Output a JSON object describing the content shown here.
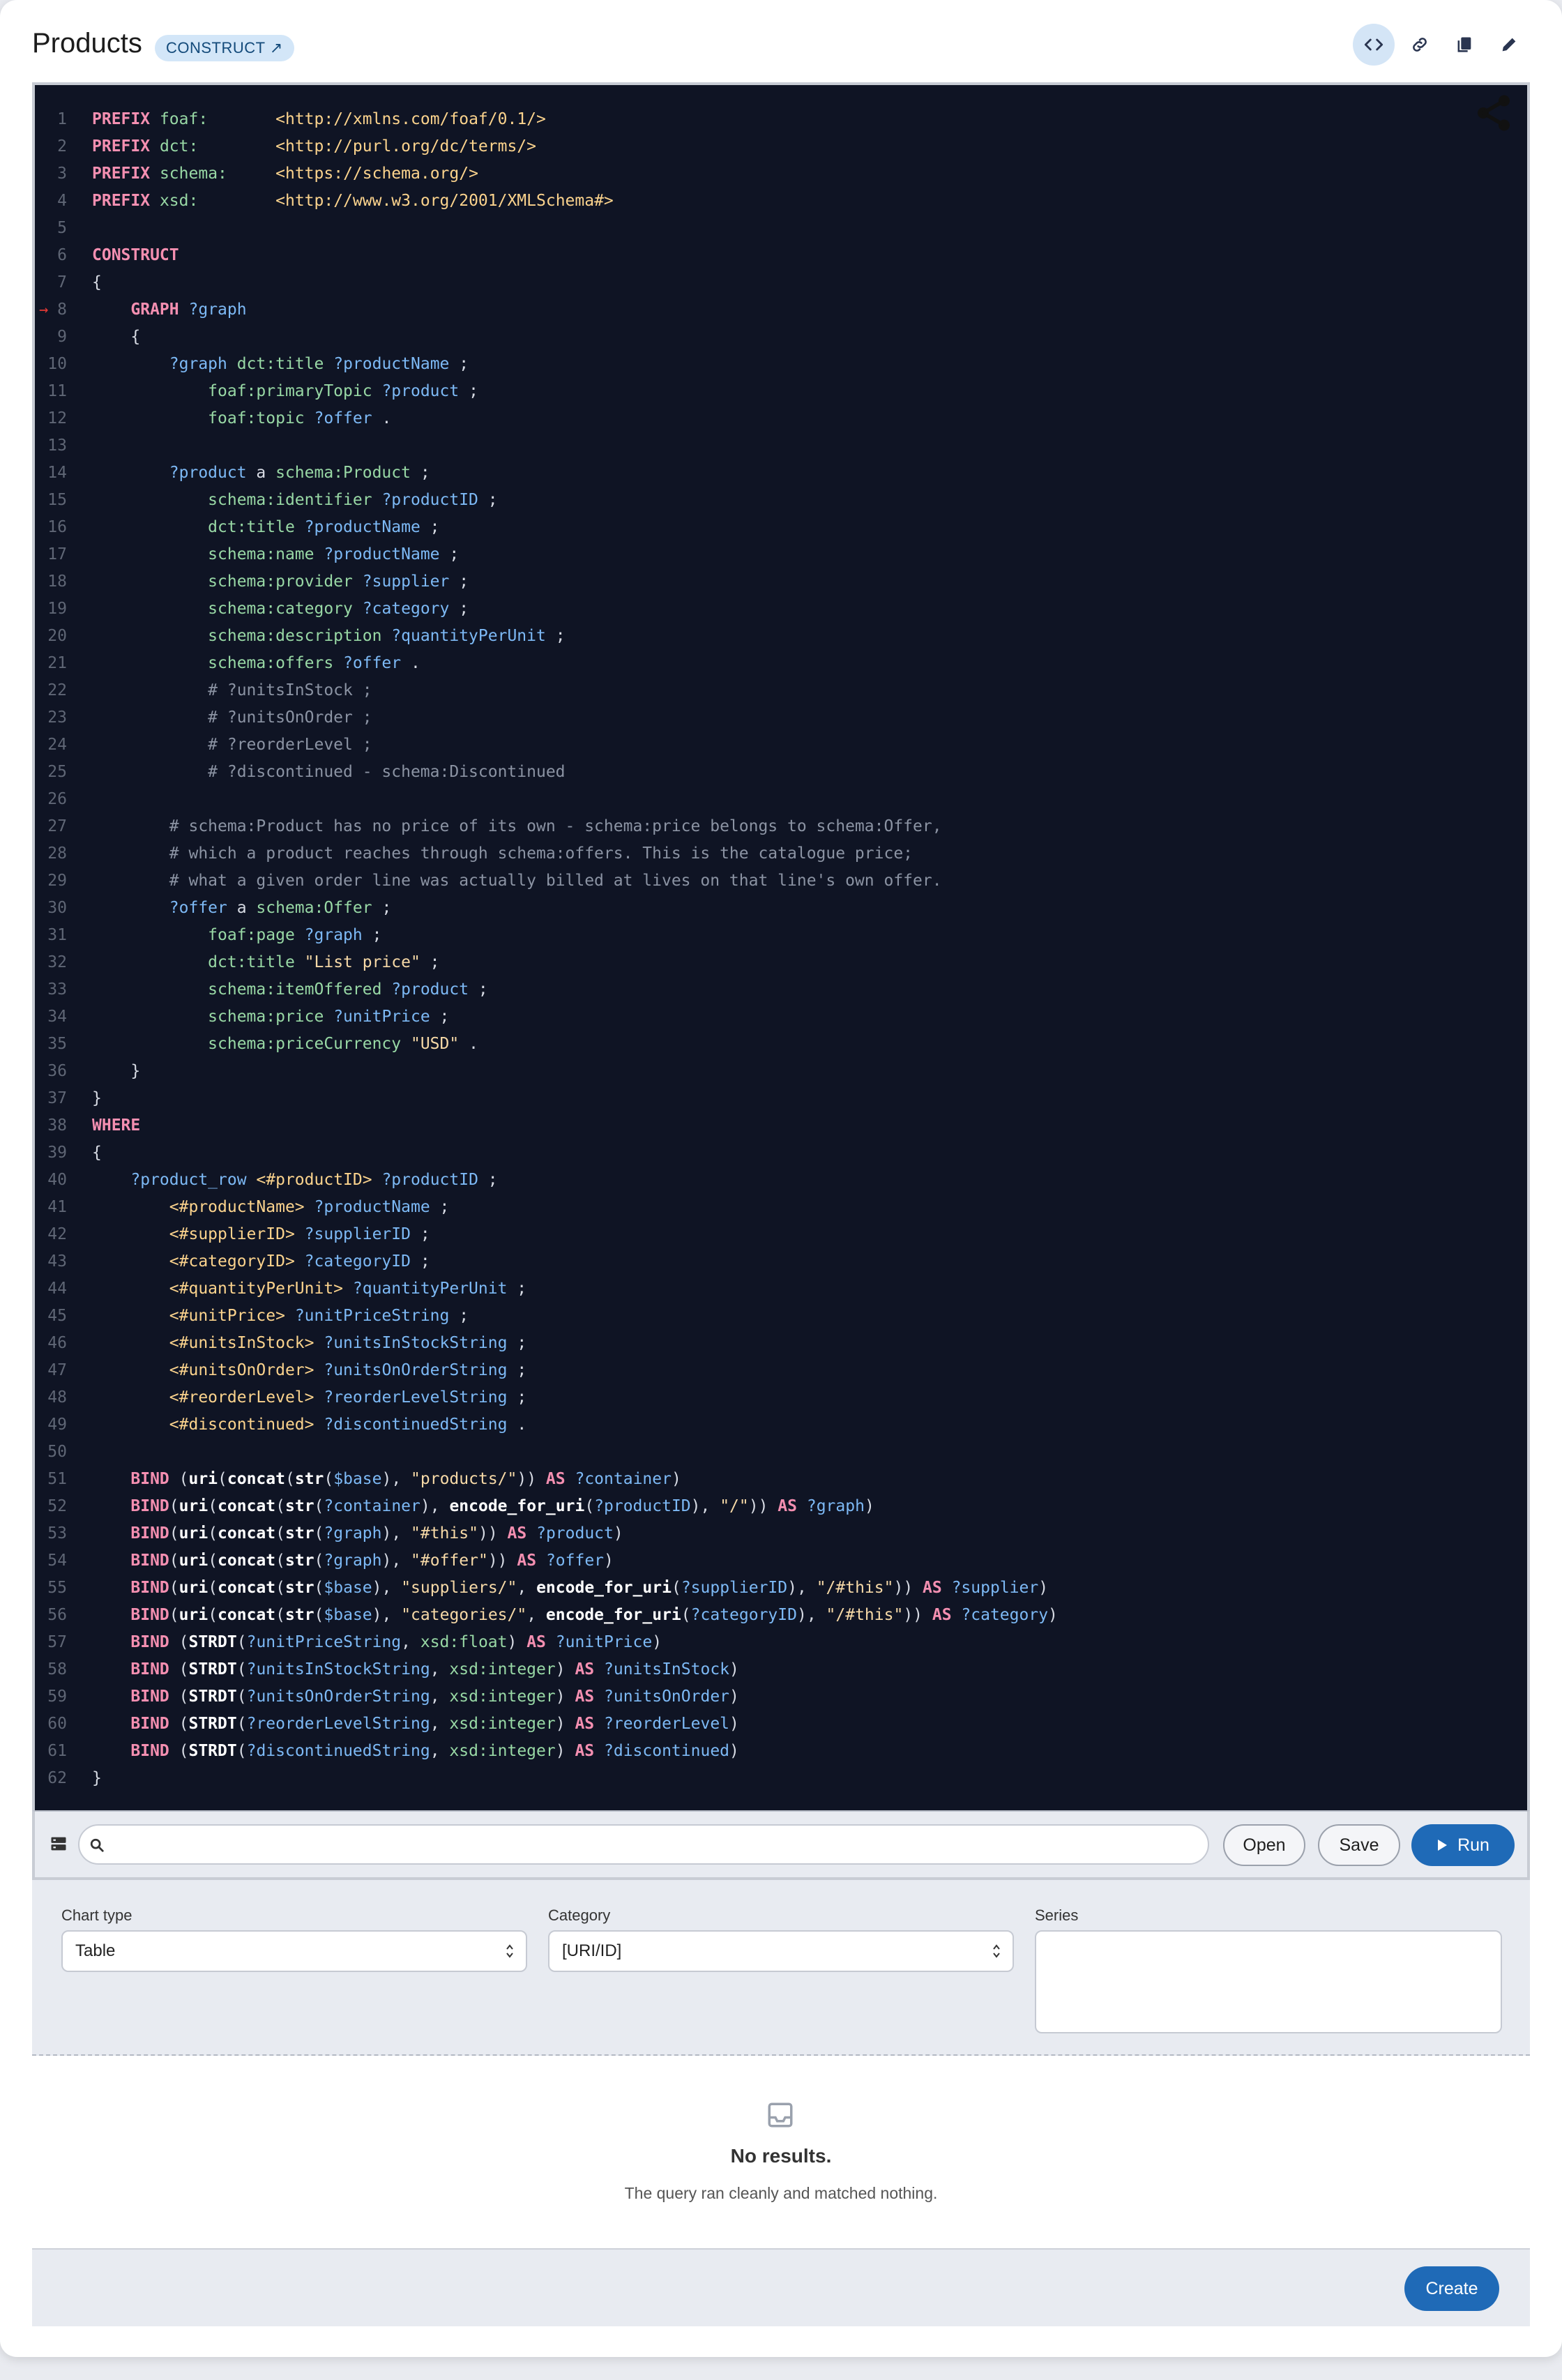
{
  "header": {
    "title": "Products",
    "badge": "CONSTRUCT ↗",
    "buttons": [
      "code-view",
      "link",
      "copy",
      "edit"
    ]
  },
  "colors": {
    "accent": "#1f6ab7",
    "editor_bg": "#0f1424",
    "badge_bg": "#d3e6f8"
  },
  "editor": {
    "lines": [
      "<span class=\"k\">PREFIX</span> <span class=\"p\">foaf:</span>       <span class=\"i\">&lt;http://xmlns.com/foaf/0.1/&gt;</span>",
      "<span class=\"k\">PREFIX</span> <span class=\"p\">dct:</span>        <span class=\"i\">&lt;http://purl.org/dc/terms/&gt;</span>",
      "<span class=\"k\">PREFIX</span> <span class=\"p\">schema:</span>     <span class=\"i\">&lt;https://schema.org/&gt;</span>",
      "<span class=\"k\">PREFIX</span> <span class=\"p\">xsd:</span>        <span class=\"i\">&lt;http://www.w3.org/2001/XMLSchema#&gt;</span>",
      "",
      "<span class=\"k\">CONSTRUCT</span>",
      "{",
      "    <span class=\"k\">GRAPH</span> <span class=\"v\">?graph</span>",
      "    {",
      "        <span class=\"v\">?graph</span> <span class=\"p\">dct:title</span> <span class=\"v\">?productName</span> ;",
      "            <span class=\"p\">foaf:primaryTopic</span> <span class=\"v\">?product</span> ;",
      "            <span class=\"p\">foaf:topic</span> <span class=\"v\">?offer</span> .",
      "",
      "        <span class=\"v\">?product</span> a <span class=\"p\">schema:Product</span> ;",
      "            <span class=\"p\">schema:identifier</span> <span class=\"v\">?productID</span> ;",
      "            <span class=\"p\">dct:title</span> <span class=\"v\">?productName</span> ;",
      "            <span class=\"p\">schema:name</span> <span class=\"v\">?productName</span> ;",
      "            <span class=\"p\">schema:provider</span> <span class=\"v\">?supplier</span> ;",
      "            <span class=\"p\">schema:category</span> <span class=\"v\">?category</span> ;",
      "            <span class=\"p\">schema:description</span> <span class=\"v\">?quantityPerUnit</span> ;",
      "            <span class=\"p\">schema:offers</span> <span class=\"v\">?offer</span> .",
      "            <span class=\"c\"># ?unitsInStock ;</span>",
      "            <span class=\"c\"># ?unitsOnOrder ;</span>",
      "            <span class=\"c\"># ?reorderLevel ;</span>",
      "            <span class=\"c\"># ?discontinued - schema:Discontinued</span>",
      "",
      "        <span class=\"c\"># schema:Product has no price of its own - schema:price belongs to schema:Offer,</span>",
      "        <span class=\"c\"># which a product reaches through schema:offers. This is the catalogue price;</span>",
      "        <span class=\"c\"># what a given order line was actually billed at lives on that line's own offer.</span>",
      "        <span class=\"v\">?offer</span> a <span class=\"p\">schema:Offer</span> ;",
      "            <span class=\"p\">foaf:page</span> <span class=\"v\">?graph</span> ;",
      "            <span class=\"p\">dct:title</span> <span class=\"s\">\"List price\"</span> ;",
      "            <span class=\"p\">schema:itemOffered</span> <span class=\"v\">?product</span> ;",
      "            <span class=\"p\">schema:price</span> <span class=\"v\">?unitPrice</span> ;",
      "            <span class=\"p\">schema:priceCurrency</span> <span class=\"s\">\"USD\"</span> .",
      "    }",
      "}",
      "<span class=\"k\">WHERE</span>",
      "{",
      "    <span class=\"v\">?product_row</span> <span class=\"i\">&lt;#productID&gt;</span> <span class=\"v\">?productID</span> ;",
      "        <span class=\"i\">&lt;#productName&gt;</span> <span class=\"v\">?productName</span> ;",
      "        <span class=\"i\">&lt;#supplierID&gt;</span> <span class=\"v\">?supplierID</span> ;",
      "        <span class=\"i\">&lt;#categoryID&gt;</span> <span class=\"v\">?categoryID</span> ;",
      "        <span class=\"i\">&lt;#quantityPerUnit&gt;</span> <span class=\"v\">?quantityPerUnit</span> ;",
      "        <span class=\"i\">&lt;#unitPrice&gt;</span> <span class=\"v\">?unitPriceString</span> ;",
      "        <span class=\"i\">&lt;#unitsInStock&gt;</span> <span class=\"v\">?unitsInStockString</span> ;",
      "        <span class=\"i\">&lt;#unitsOnOrder&gt;</span> <span class=\"v\">?unitsOnOrderString</span> ;",
      "        <span class=\"i\">&lt;#reorderLevel&gt;</span> <span class=\"v\">?reorderLevelString</span> ;",
      "        <span class=\"i\">&lt;#discontinued&gt;</span> <span class=\"v\">?discontinuedString</span> .",
      "",
      "    <span class=\"k\">BIND</span> (<span class=\"f\">uri</span>(<span class=\"f\">concat</span>(<span class=\"f\">str</span>(<span class=\"v\">$base</span>), <span class=\"s\">\"products/\"</span>)) <span class=\"k\">AS</span> <span class=\"v\">?container</span>)",
      "    <span class=\"k\">BIND</span>(<span class=\"f\">uri</span>(<span class=\"f\">concat</span>(<span class=\"f\">str</span>(<span class=\"v\">?container</span>), <span class=\"f\">encode_for_uri</span>(<span class=\"v\">?productID</span>), <span class=\"s\">\"/\"</span>)) <span class=\"k\">AS</span> <span class=\"v\">?graph</span>)",
      "    <span class=\"k\">BIND</span>(<span class=\"f\">uri</span>(<span class=\"f\">concat</span>(<span class=\"f\">str</span>(<span class=\"v\">?graph</span>), <span class=\"s\">\"#this\"</span>)) <span class=\"k\">AS</span> <span class=\"v\">?product</span>)",
      "    <span class=\"k\">BIND</span>(<span class=\"f\">uri</span>(<span class=\"f\">concat</span>(<span class=\"f\">str</span>(<span class=\"v\">?graph</span>), <span class=\"s\">\"#offer\"</span>)) <span class=\"k\">AS</span> <span class=\"v\">?offer</span>)",
      "    <span class=\"k\">BIND</span>(<span class=\"f\">uri</span>(<span class=\"f\">concat</span>(<span class=\"f\">str</span>(<span class=\"v\">$base</span>), <span class=\"s\">\"suppliers/\"</span>, <span class=\"f\">encode_for_uri</span>(<span class=\"v\">?supplierID</span>), <span class=\"s\">\"/#this\"</span>)) <span class=\"k\">AS</span> <span class=\"v\">?supplier</span>)",
      "    <span class=\"k\">BIND</span>(<span class=\"f\">uri</span>(<span class=\"f\">concat</span>(<span class=\"f\">str</span>(<span class=\"v\">$base</span>), <span class=\"s\">\"categories/\"</span>, <span class=\"f\">encode_for_uri</span>(<span class=\"v\">?categoryID</span>), <span class=\"s\">\"/#this\"</span>)) <span class=\"k\">AS</span> <span class=\"v\">?category</span>)",
      "    <span class=\"k\">BIND</span> (<span class=\"f\">STRDT</span>(<span class=\"v\">?unitPriceString</span>, <span class=\"p\">xsd:float</span>) <span class=\"k\">AS</span> <span class=\"v\">?unitPrice</span>)",
      "    <span class=\"k\">BIND</span> (<span class=\"f\">STRDT</span>(<span class=\"v\">?unitsInStockString</span>, <span class=\"p\">xsd:integer</span>) <span class=\"k\">AS</span> <span class=\"v\">?unitsInStock</span>)",
      "    <span class=\"k\">BIND</span> (<span class=\"f\">STRDT</span>(<span class=\"v\">?unitsOnOrderString</span>, <span class=\"p\">xsd:integer</span>) <span class=\"k\">AS</span> <span class=\"v\">?unitsOnOrder</span>)",
      "    <span class=\"k\">BIND</span> (<span class=\"f\">STRDT</span>(<span class=\"v\">?reorderLevelString</span>, <span class=\"p\">xsd:integer</span>) <span class=\"k\">AS</span> <span class=\"v\">?reorderLevel</span>)",
      "    <span class=\"k\">BIND</span> (<span class=\"f\">STRDT</span>(<span class=\"v\">?discontinuedString</span>, <span class=\"p\">xsd:integer</span>) <span class=\"k\">AS</span> <span class=\"v\">?discontinued</span>)",
      "}"
    ],
    "marker_line": 8,
    "marker": "→"
  },
  "querybar": {
    "search_value": "",
    "open_label": "Open",
    "save_label": "Save",
    "run_label": "Run"
  },
  "chart_config": {
    "chart_type_label": "Chart type",
    "chart_type_value": "Table",
    "category_label": "Category",
    "category_value": "[URI/ID]",
    "series_label": "Series"
  },
  "results": {
    "title": "No results.",
    "subtitle": "The query ran cleanly and matched nothing."
  },
  "footer": {
    "create_label": "Create"
  }
}
